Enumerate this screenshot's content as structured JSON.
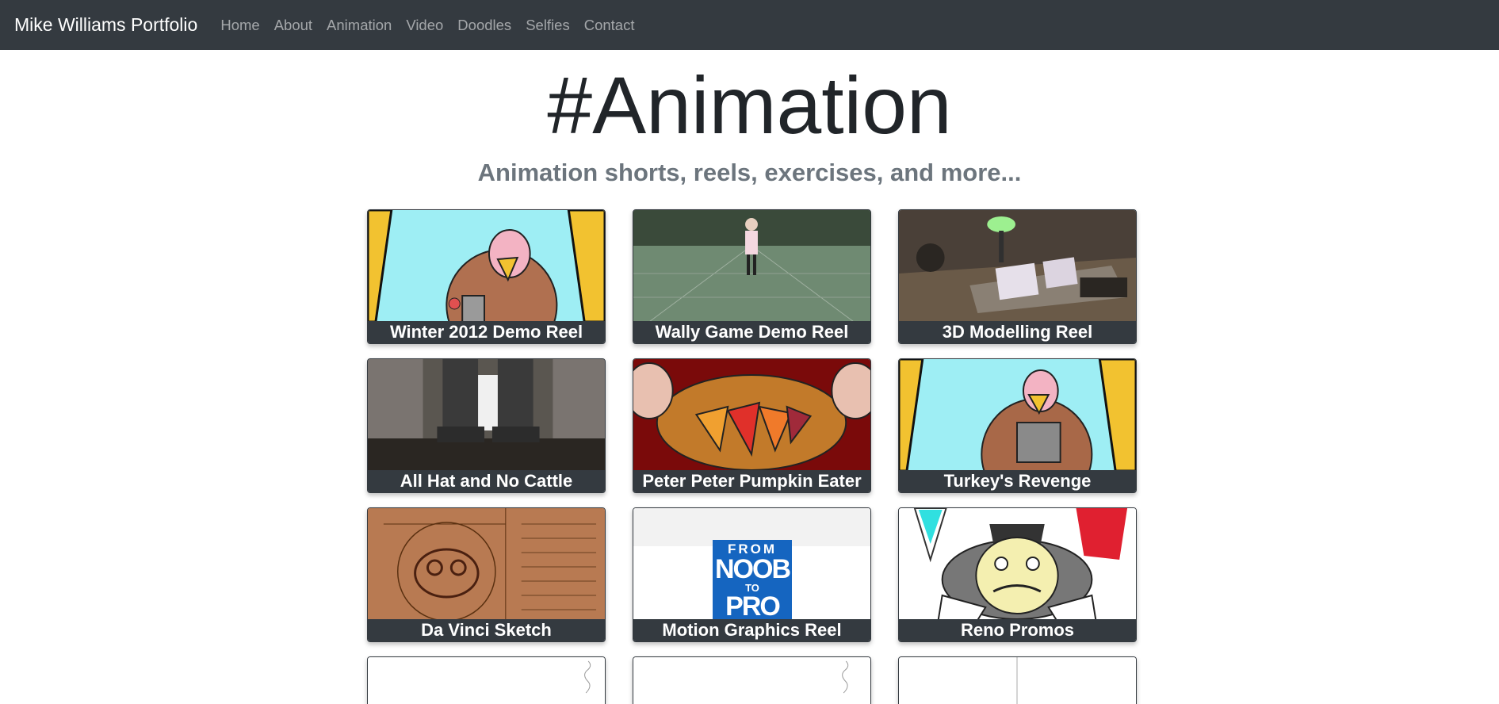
{
  "nav": {
    "brand": "Mike Williams Portfolio",
    "links": [
      "Home",
      "About",
      "Animation",
      "Video",
      "Doodles",
      "Selfies",
      "Contact"
    ]
  },
  "hero": {
    "title": "#Animation",
    "subtitle": "Animation shorts, reels, exercises, and more..."
  },
  "cards": [
    {
      "title": "Winter 2012 Demo Reel"
    },
    {
      "title": "Wally Game Demo Reel"
    },
    {
      "title": "3D Modelling Reel"
    },
    {
      "title": "All Hat and No Cattle"
    },
    {
      "title": "Peter Peter Pumpkin Eater"
    },
    {
      "title": "Turkey's Revenge"
    },
    {
      "title": "Da Vinci Sketch"
    },
    {
      "title": "Motion Graphics Reel",
      "logo_text": [
        "FROM",
        "NOOB",
        "TO",
        "PRO"
      ]
    },
    {
      "title": "Reno Promos"
    }
  ],
  "colors": {
    "navbar": "#343a40",
    "caption_bg": "#343a40",
    "nav_link": "rgba(255,255,255,0.55)",
    "subtitle": "#6c757d",
    "logo_blue": "#1565c0"
  }
}
